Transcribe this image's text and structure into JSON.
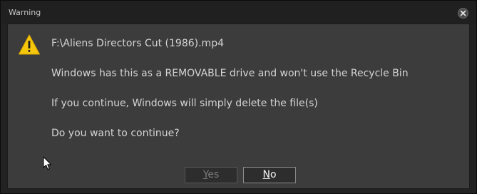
{
  "window": {
    "title": "Warning"
  },
  "icons": {
    "warning": "warning-icon",
    "close": "close-icon",
    "cursor": "mouse-cursor-icon"
  },
  "colors": {
    "warning_yellow": "#f6c60b",
    "text": "#d4d4d4",
    "panel": "#3c3c3c",
    "titlebar": "#202020"
  },
  "message": {
    "file_path": "F:\\Aliens Directors Cut (1986).mp4",
    "line1": "Windows has this as a REMOVABLE drive and won't use the Recycle Bin",
    "line2": "If you continue, Windows will simply delete the file(s)",
    "question": "Do you want to continue?"
  },
  "buttons": {
    "yes": {
      "mnemonic": "Y",
      "rest": "es",
      "enabled": false
    },
    "no": {
      "mnemonic": "N",
      "rest": "o",
      "enabled": true
    }
  }
}
